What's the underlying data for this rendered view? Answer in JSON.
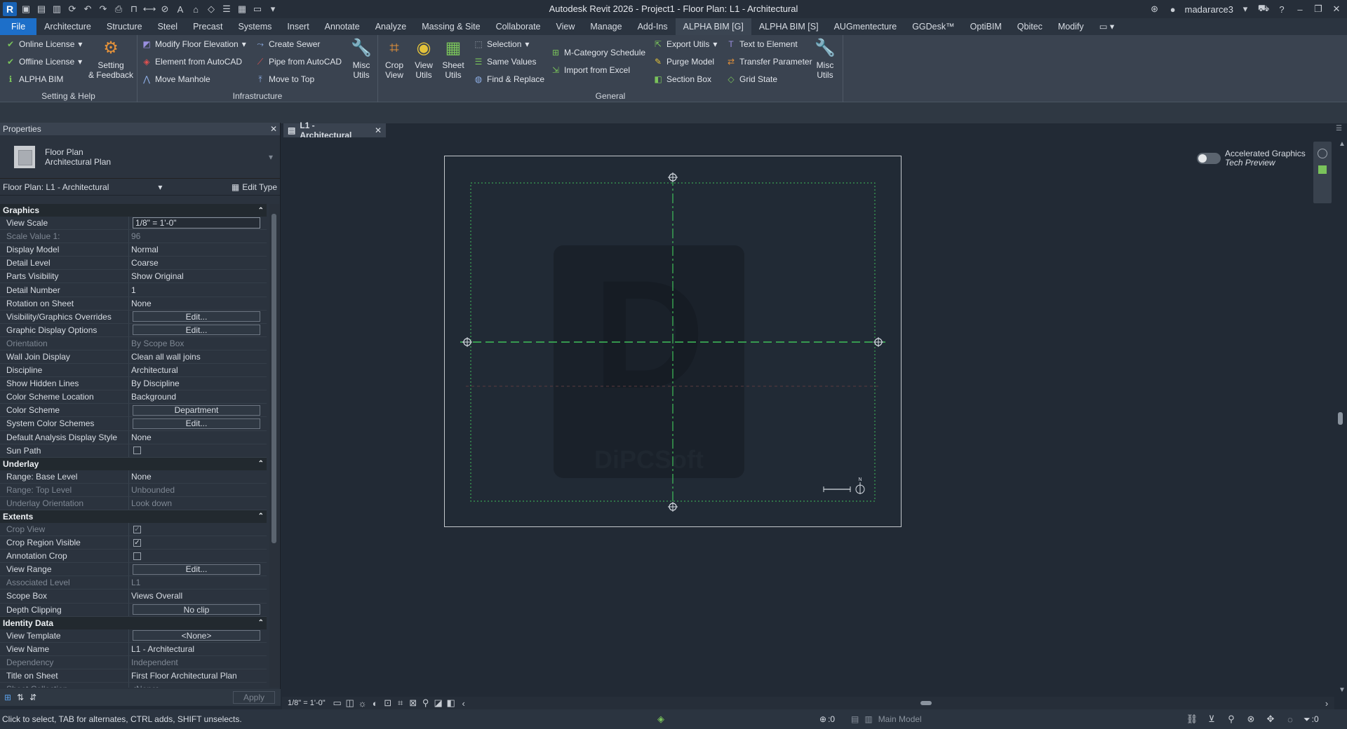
{
  "app": {
    "title": "Autodesk Revit 2026 - Project1 - Floor Plan: L1 - Architectural",
    "user": "madararce3"
  },
  "tabs": [
    "File",
    "Architecture",
    "Structure",
    "Steel",
    "Precast",
    "Systems",
    "Insert",
    "Annotate",
    "Analyze",
    "Massing & Site",
    "Collaborate",
    "View",
    "Manage",
    "Add-Ins",
    "ALPHA BIM [G]",
    "ALPHA BIM [S]",
    "AUGmentecture",
    "GGDesk™",
    "OptiBIM",
    "Qbitec",
    "Modify"
  ],
  "ribbon": {
    "setting_help": {
      "label": "Setting & Help",
      "online_license": "Online License",
      "offline_license": "Offline License",
      "alpha_bim": "ALPHA BIM",
      "setting_feedback_1": "Setting",
      "setting_feedback_2": "& Feedback"
    },
    "infrastructure": {
      "label": "Infrastructure",
      "modify_floor_elevation": "Modify Floor Elevation",
      "element_from_autocad": "Element from AutoCAD",
      "move_manhole": "Move Manhole",
      "create_sewer": "Create Sewer",
      "pipe_from_autocad": "Pipe from AutoCAD",
      "move_to_top": "Move to Top",
      "misc_utils_1": "Misc",
      "misc_utils_2": "Utils"
    },
    "general": {
      "label": "General",
      "crop_view_1": "Crop",
      "crop_view_2": "View",
      "view_utils_1": "View",
      "view_utils_2": "Utils",
      "sheet_utils_1": "Sheet",
      "sheet_utils_2": "Utils",
      "selection": "Selection",
      "same_values": "Same Values",
      "find_replace": "Find & Replace",
      "mcategory_schedule": "M-Category Schedule",
      "import_from_excel": "Import from Excel",
      "export_utils": "Export Utils",
      "purge_model": "Purge Model",
      "section_box": "Section Box",
      "text_to_element": "Text to Element",
      "transfer_parameter": "Transfer Parameter",
      "grid_state": "Grid State",
      "misc_utils_1": "Misc",
      "misc_utils_2": "Utils"
    }
  },
  "properties": {
    "title": "Properties",
    "type_name_1": "Floor Plan",
    "type_name_2": "Architectural Plan",
    "instance": "Floor Plan: L1 - Architectural",
    "edit_type": "Edit Type",
    "apply": "Apply",
    "groups": [
      {
        "name": "Graphics",
        "rows": [
          {
            "name": "View Scale",
            "value": "1/8\" = 1'-0\"",
            "kind": "input"
          },
          {
            "name": "Scale Value    1:",
            "value": "96",
            "kind": "dim"
          },
          {
            "name": "Display Model",
            "value": "Normal",
            "kind": "text"
          },
          {
            "name": "Detail Level",
            "value": "Coarse",
            "kind": "text"
          },
          {
            "name": "Parts Visibility",
            "value": "Show Original",
            "kind": "text"
          },
          {
            "name": "Detail Number",
            "value": "1",
            "kind": "text"
          },
          {
            "name": "Rotation on Sheet",
            "value": "None",
            "kind": "text"
          },
          {
            "name": "Visibility/Graphics Overrides",
            "value": "Edit...",
            "kind": "button"
          },
          {
            "name": "Graphic Display Options",
            "value": "Edit...",
            "kind": "button"
          },
          {
            "name": "Orientation",
            "value": "By Scope Box",
            "kind": "dim"
          },
          {
            "name": "Wall Join Display",
            "value": "Clean all wall joins",
            "kind": "text"
          },
          {
            "name": "Discipline",
            "value": "Architectural",
            "kind": "text"
          },
          {
            "name": "Show Hidden Lines",
            "value": "By Discipline",
            "kind": "text"
          },
          {
            "name": "Color Scheme Location",
            "value": "Background",
            "kind": "text"
          },
          {
            "name": "Color Scheme",
            "value": "Department",
            "kind": "button"
          },
          {
            "name": "System Color Schemes",
            "value": "Edit...",
            "kind": "button"
          },
          {
            "name": "Default Analysis Display Style",
            "value": "None",
            "kind": "text"
          },
          {
            "name": "Sun Path",
            "value": "",
            "kind": "check",
            "checked": false
          }
        ]
      },
      {
        "name": "Underlay",
        "rows": [
          {
            "name": "Range: Base Level",
            "value": "None",
            "kind": "text"
          },
          {
            "name": "Range: Top Level",
            "value": "Unbounded",
            "kind": "dim"
          },
          {
            "name": "Underlay Orientation",
            "value": "Look down",
            "kind": "dim"
          }
        ]
      },
      {
        "name": "Extents",
        "rows": [
          {
            "name": "Crop View",
            "value": "",
            "kind": "check",
            "checked": true,
            "disabled": true
          },
          {
            "name": "Crop Region Visible",
            "value": "",
            "kind": "check",
            "checked": true
          },
          {
            "name": "Annotation Crop",
            "value": "",
            "kind": "check",
            "checked": false
          },
          {
            "name": "View Range",
            "value": "Edit...",
            "kind": "button"
          },
          {
            "name": "Associated Level",
            "value": "L1",
            "kind": "dim"
          },
          {
            "name": "Scope Box",
            "value": "Views Overall",
            "kind": "text"
          },
          {
            "name": "Depth Clipping",
            "value": "No clip",
            "kind": "button"
          }
        ]
      },
      {
        "name": "Identity Data",
        "rows": [
          {
            "name": "View Template",
            "value": "<None>",
            "kind": "button"
          },
          {
            "name": "View Name",
            "value": "L1 - Architectural",
            "kind": "text"
          },
          {
            "name": "Dependency",
            "value": "Independent",
            "kind": "dim"
          },
          {
            "name": "Title on Sheet",
            "value": "First Floor Architectural Plan",
            "kind": "text"
          },
          {
            "name": "Sheet Collection",
            "value": "<None>",
            "kind": "dim"
          }
        ]
      }
    ]
  },
  "view": {
    "tab_title": "L1 - Architectural",
    "accel_1": "Accelerated Graphics",
    "accel_2": "Tech Preview",
    "watermark": "DiPCSoft",
    "watermark_letter": "D",
    "scale": "1/8\" = 1'-0\""
  },
  "status": {
    "message": "Click to select, TAB for alternates, CTRL adds, SHIFT unselects.",
    "workset_count": ":0",
    "main_model": "Main Model",
    "filter_count": ":0"
  }
}
